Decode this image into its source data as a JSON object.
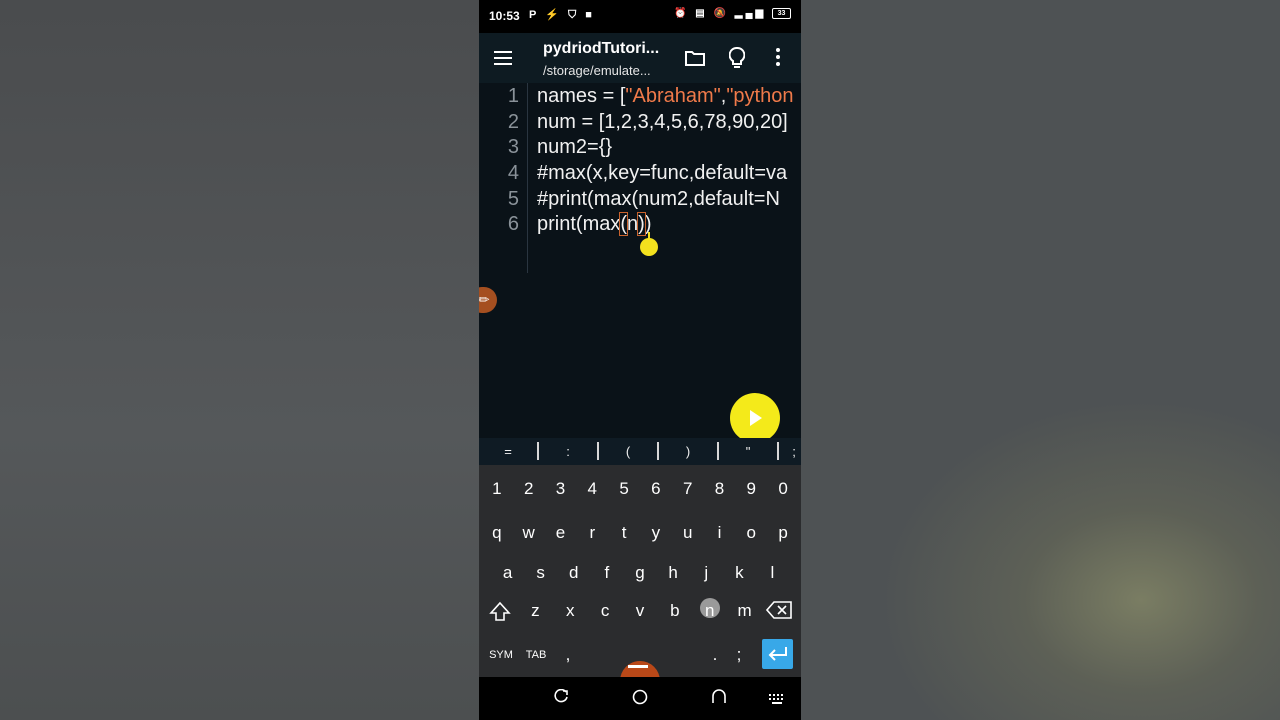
{
  "status_bar": {
    "time": "10:53",
    "left_icons": "P ⚡ ⛉ ■",
    "battery": "33"
  },
  "app_bar": {
    "title": "pydriodTutori...",
    "subtitle": "/storage/emulate..."
  },
  "editor": {
    "line_numbers": [
      "1",
      "2",
      "3",
      "4",
      "5",
      "6"
    ],
    "lines": {
      "l1_a": "names = [",
      "l1_s1": "\"Abraham\"",
      "l1_b": ",",
      "l1_s2": "\"python",
      "l2": "num = [1,2,3,4,5,6,78,90,20]",
      "l3": "num2={}",
      "l4": "#max(x,key=func,default=va",
      "l5": "#print(max(num2,default=N",
      "l6_a": "print(max",
      "l6_b": "(",
      "l6_c": "n",
      "l6_d": ")",
      "l6_e": ")"
    }
  },
  "symbol_bar": [
    "=",
    ":",
    "(",
    ")",
    "\"",
    ";"
  ],
  "keyboard": {
    "row1": [
      "1",
      "2",
      "3",
      "4",
      "5",
      "6",
      "7",
      "8",
      "9",
      "0"
    ],
    "row2": [
      "q",
      "w",
      "e",
      "r",
      "t",
      "y",
      "u",
      "i",
      "o",
      "p"
    ],
    "row3": [
      "a",
      "s",
      "d",
      "f",
      "g",
      "h",
      "j",
      "k",
      "l"
    ],
    "row4": [
      "z",
      "x",
      "c",
      "v",
      "b",
      "n",
      "m"
    ],
    "row5": {
      "sym": "SYM",
      "tab": "TAB",
      "comma": ",",
      "period": ".",
      "semicolon": ";"
    }
  },
  "colors": {
    "accent_yellow": "#f4ea1a",
    "string_orange": "#f07a4a",
    "enter_blue": "#38a8e8"
  }
}
